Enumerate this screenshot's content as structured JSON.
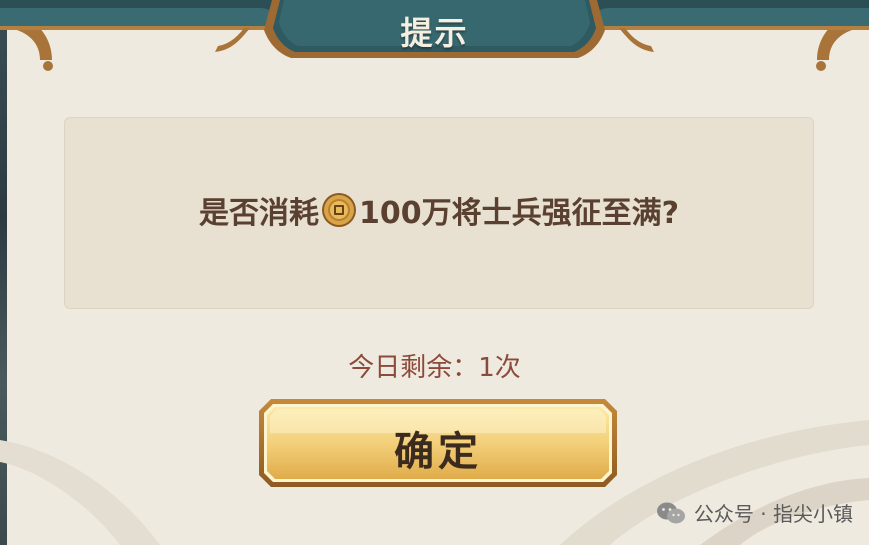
{
  "dialog": {
    "title": "提示",
    "message_before": "是否消耗",
    "message_after": "100万将士兵强征至满?",
    "currency_icon": "copper-coin-icon",
    "remaining": "今日剩余：1次",
    "confirm_label": "确定"
  },
  "watermark": {
    "text": "公众号 · 指尖小镇",
    "icon": "wechat-logo-icon"
  },
  "colors": {
    "panel_bg": "#efeae0",
    "header_teal": "#2f5a62",
    "frame_bronze": "#a8743a",
    "message_text": "#5a4030",
    "remaining_text": "#8c4a3a",
    "button_gold": "#f2d27a"
  }
}
